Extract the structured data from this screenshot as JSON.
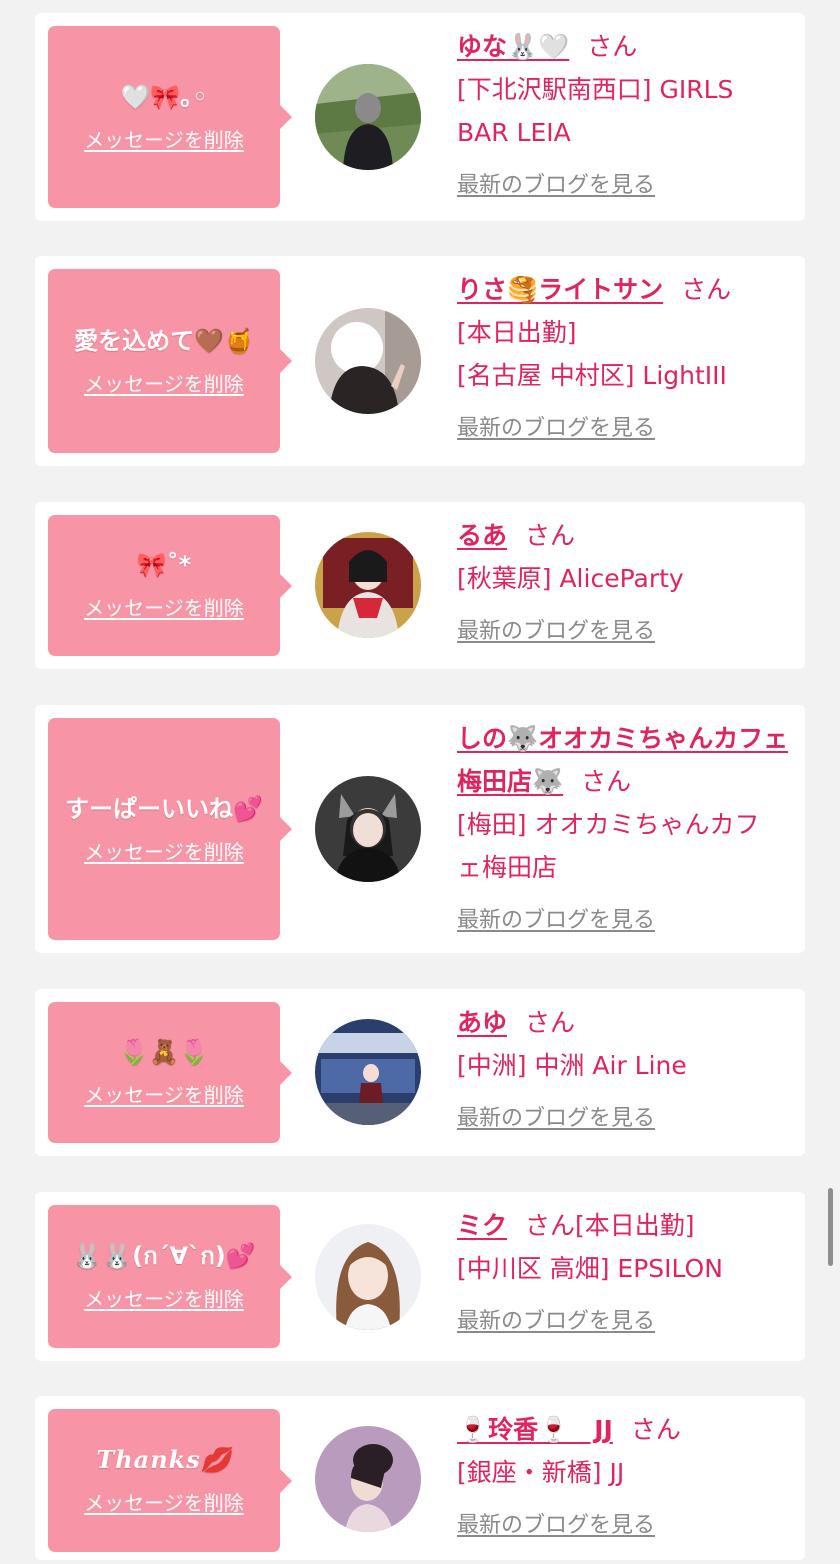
{
  "delete_label": "メッセージを削除",
  "blog_label": "最新のブログを見る",
  "san_suffix": "さん",
  "colors": {
    "background": "#f2f2f2",
    "card": "#ffffff",
    "bubble": "#f795a6",
    "accent": "#e0245e",
    "link_gray": "#8a8a8a"
  },
  "items": [
    {
      "message": "🤍🎀｡◦",
      "name": "ゆな🐰🤍",
      "shop_lines": [
        "[下北沢駅南西口] GIRLS",
        "BAR LEIA"
      ],
      "avatar": "photo-greenhouse"
    },
    {
      "message": "愛を込めて🤎🍯",
      "name": "りさ🥞ライトサン",
      "shop_lines": [
        "[本日出勤]",
        "[名古屋 中村区] LightIII"
      ],
      "avatar": "photo-peace-sign"
    },
    {
      "message": "🎀˚*",
      "name": "るあ",
      "shop_lines": [
        "[秋葉原] AliceParty"
      ],
      "avatar": "photo-maid"
    },
    {
      "message": "すーぱーいいね💕",
      "name": "しの🐺オオカミちゃんカフェ梅田店🐺",
      "shop_lines": [
        "[梅田] オオカミちゃんカフ",
        "ェ梅田店"
      ],
      "avatar": "photo-wolf-ears"
    },
    {
      "message": "🌷🧸🌷",
      "name": "あゆ",
      "shop_lines": [
        "[中洲] 中洲 Air Line"
      ],
      "avatar": "photo-airline"
    },
    {
      "message": "🐰🐰(ก´∀`ก)💕",
      "name": "ミク",
      "shop_lines": [
        "[本日出勤]",
        "[中川区 高畑] EPSILON"
      ],
      "avatar": "photo-portrait"
    },
    {
      "message": "Thanks💋",
      "name": "🍷玲香🍷　JJ",
      "shop_lines": [
        "[銀座・新橋] JJ"
      ],
      "avatar": "photo-updo"
    }
  ]
}
